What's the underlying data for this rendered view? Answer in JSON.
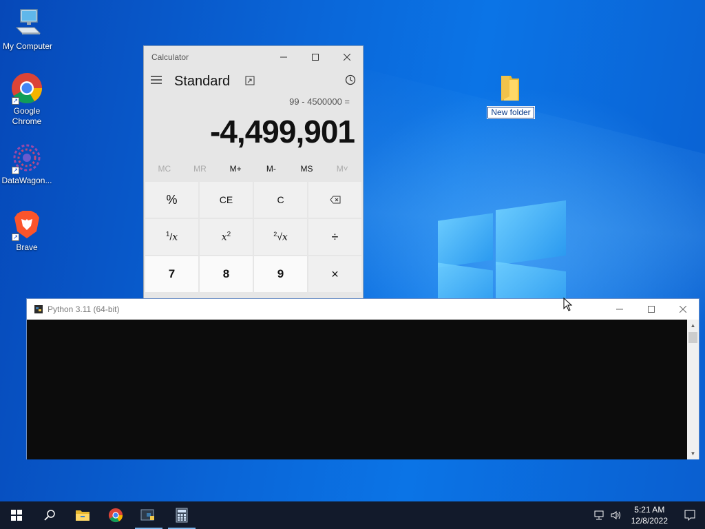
{
  "desktop": {
    "icons": [
      {
        "label": "My Computer"
      },
      {
        "label": "Google Chrome"
      },
      {
        "label": "DataWagon..."
      },
      {
        "label": "Brave"
      }
    ],
    "folder": {
      "label": "New folder"
    }
  },
  "calculator": {
    "title": "Calculator",
    "mode": "Standard",
    "expression": "99 - 4500000 =",
    "result": "-4,499,901",
    "memory": [
      "MC",
      "MR",
      "M+",
      "M-",
      "MS",
      "M˅"
    ],
    "keys": {
      "percent": "%",
      "ce": "CE",
      "c": "C",
      "backspace": "⌫",
      "reciprocal_num": "1",
      "reciprocal_var": "x",
      "square_var": "x",
      "square_exp": "2",
      "sqrt_idx": "2",
      "sqrt_var": "x",
      "divide": "÷",
      "seven": "7",
      "eight": "8",
      "nine": "9",
      "multiply": "×"
    }
  },
  "python_console": {
    "title": "Python 3.11 (64-bit)"
  },
  "taskbar": {
    "time": "5:21 AM",
    "date": "12/8/2022"
  },
  "colors": {
    "desktop_bg": "#0a63cf",
    "taskbar_bg": "#121a2b",
    "console_bg": "#0c0c0c"
  }
}
